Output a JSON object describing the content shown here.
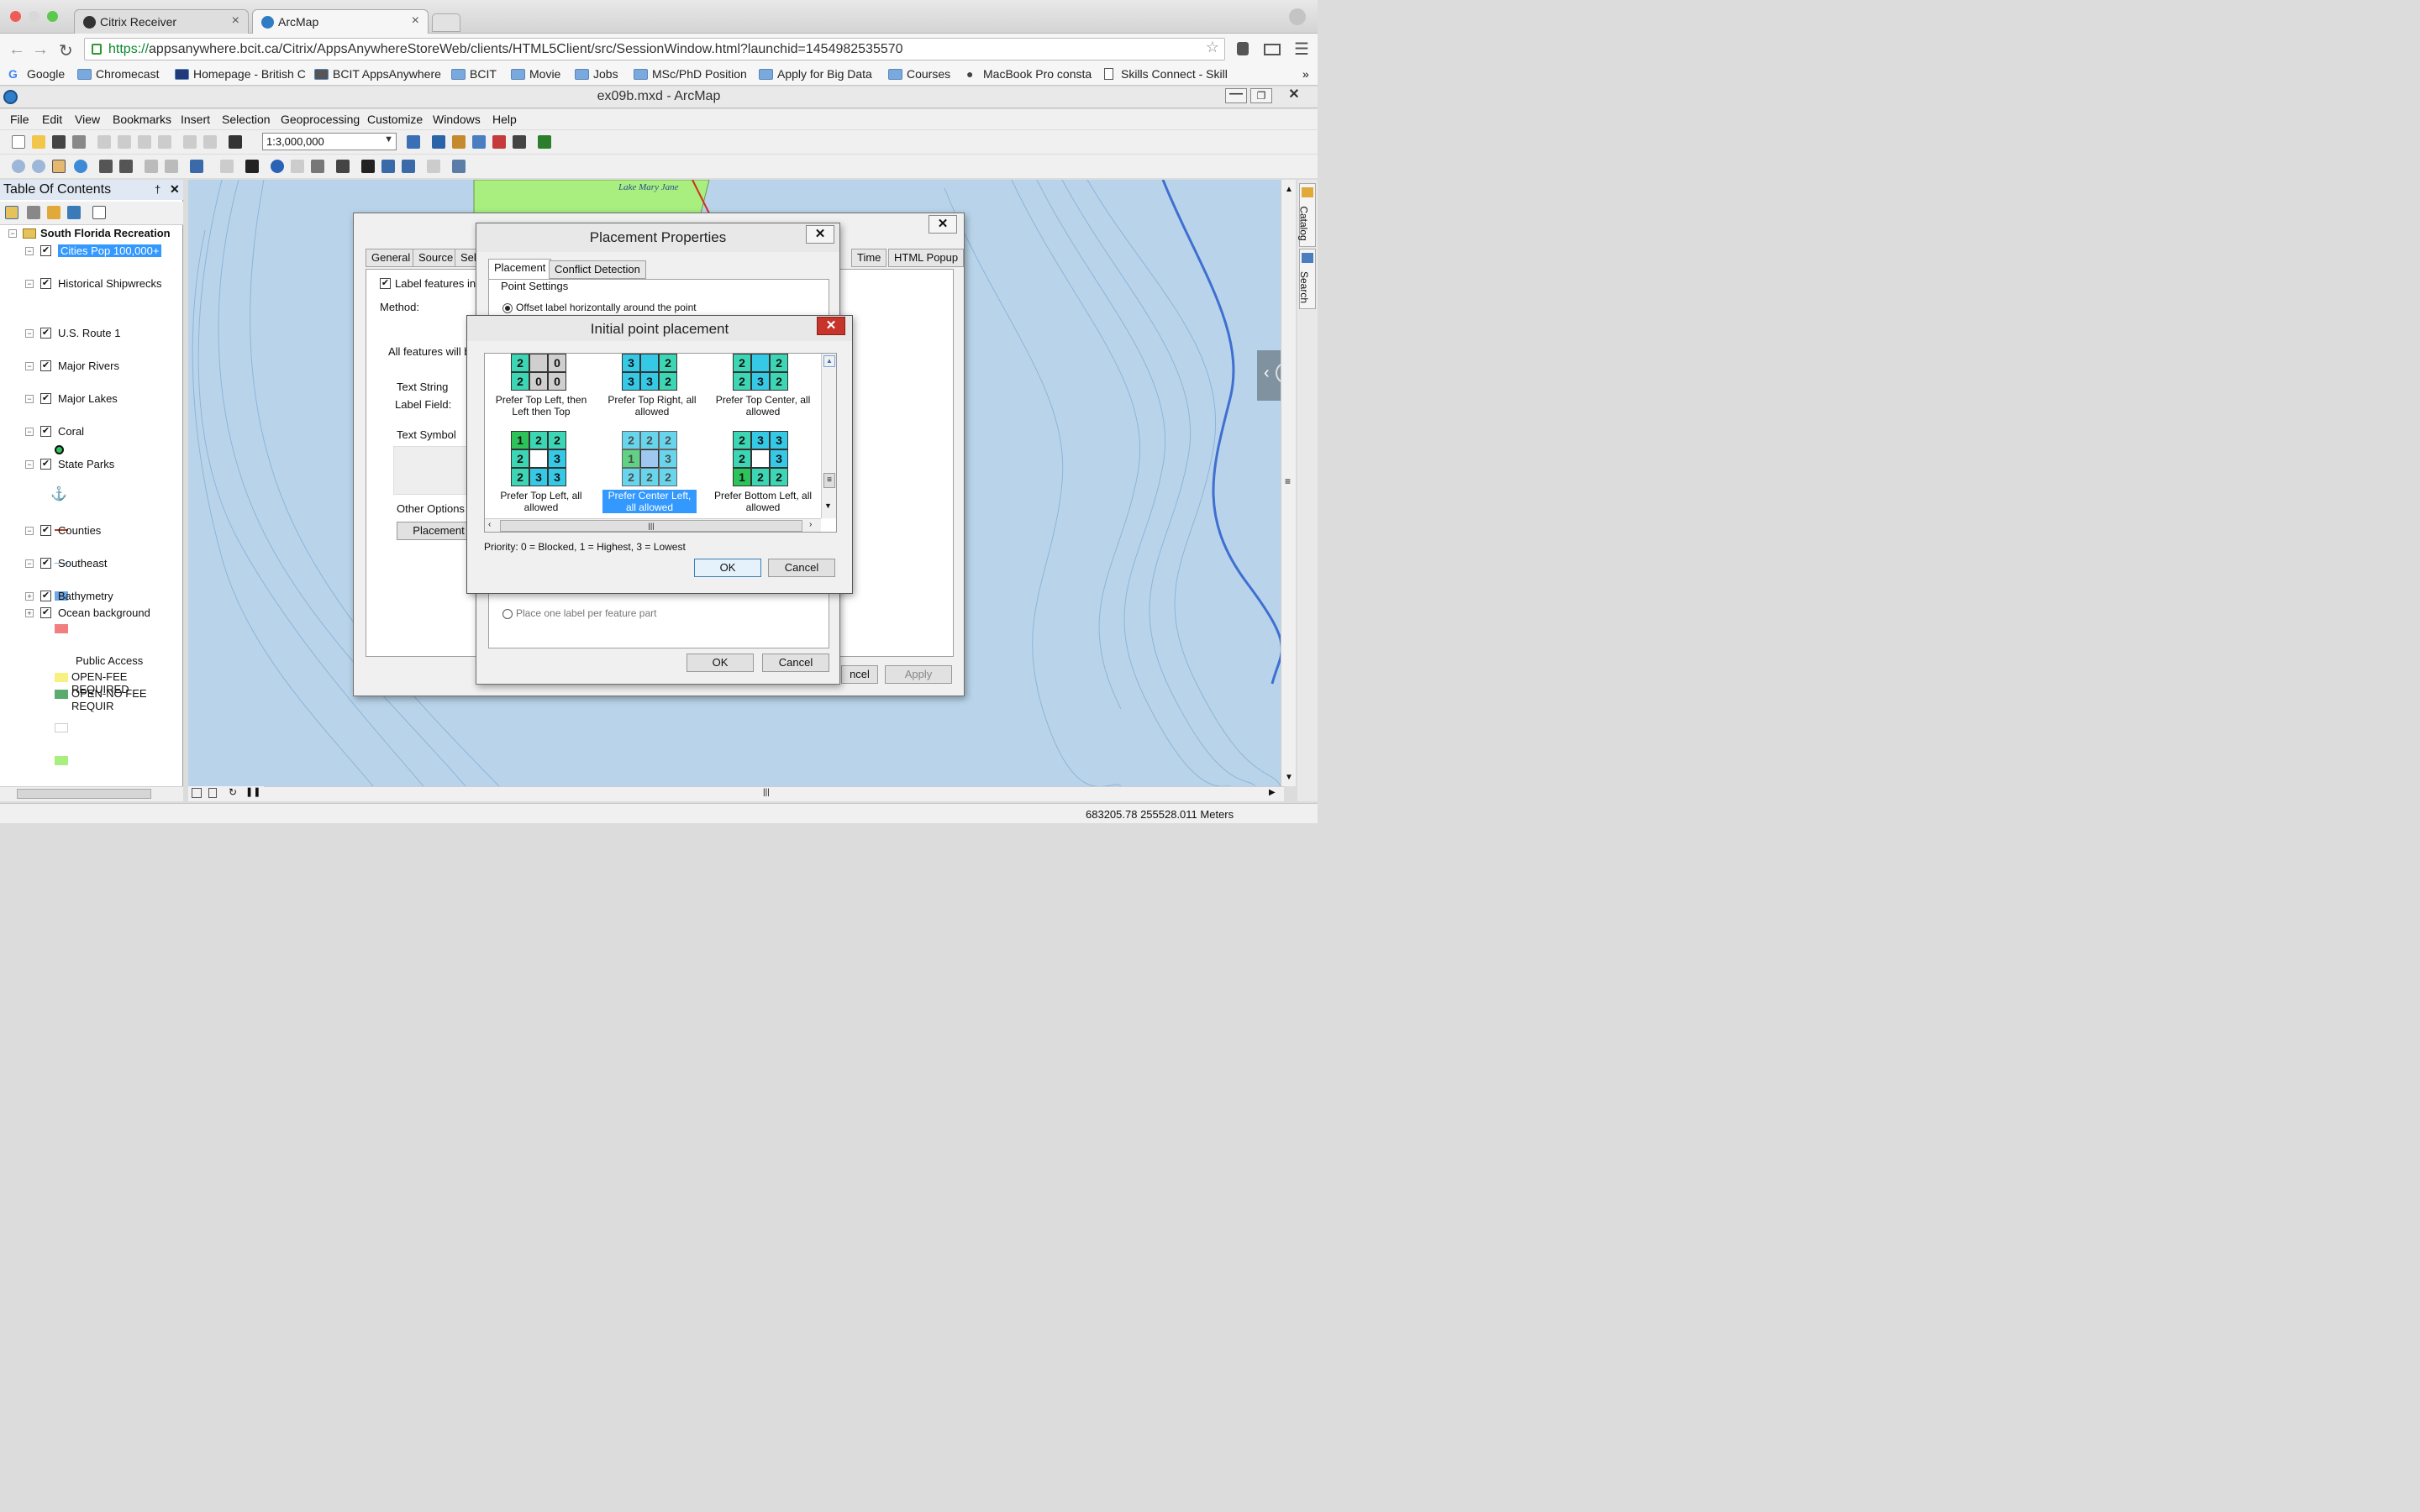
{
  "browser": {
    "tabs": [
      {
        "label": "Citrix Receiver"
      },
      {
        "label": "ArcMap"
      }
    ],
    "url_https": "https://",
    "url_rest": "appsanywhere.bcit.ca/Citrix/AppsAnywhereStoreWeb/clients/HTML5Client/src/SessionWindow.html?launchid=1454982535570",
    "bookmarks": [
      "Google",
      "Chromecast",
      "Homepage - British C",
      "BCIT AppsAnywhere",
      "BCIT",
      "Movie",
      "Jobs",
      "MSc/PhD Position",
      "Apply for Big Data",
      "Courses",
      "MacBook Pro consta",
      "Skills Connect - Skill"
    ],
    "more_bookmarks": "»"
  },
  "arcmap": {
    "title": "ex09b.mxd - ArcMap",
    "menu": [
      "File",
      "Edit",
      "View",
      "Bookmarks",
      "Insert",
      "Selection",
      "Geoprocessing",
      "Customize",
      "Windows",
      "Help"
    ],
    "scale": "1:3,000,000",
    "status_coords": "683205.78  255528.011 Meters"
  },
  "toc": {
    "title": "Table Of Contents",
    "pin": "†",
    "close": "✕",
    "dataframe": "South Florida Recreation",
    "layers": [
      {
        "name": "Cities Pop 100,000+"
      },
      {
        "name": "Historical Shipwrecks"
      },
      {
        "name": "U.S. Route 1"
      },
      {
        "name": "Major Rivers"
      },
      {
        "name": "Major Lakes"
      },
      {
        "name": "Coral"
      },
      {
        "name": "State Parks"
      },
      {
        "name": "Counties"
      },
      {
        "name": "Southeast"
      },
      {
        "name": "Bathymetry"
      },
      {
        "name": "Ocean background"
      }
    ],
    "state_parks_heading": "Public Access",
    "state_parks_classes": [
      "OPEN-FEE REQUIRED",
      "OPEN-NO FEE REQUIR"
    ]
  },
  "map": {
    "lake_label": "Lake Mary Jane",
    "right_dock": [
      "Catalog",
      "Search"
    ]
  },
  "colors": {
    "selection": "#3399ff",
    "map_water": "#b9d4ea",
    "land": "#a8ef80",
    "coral": "#f08080",
    "fee": "#f8f080",
    "nofee": "#5cab6e"
  },
  "layer_props": {
    "tabs": [
      "General",
      "Source",
      "Sele",
      "Time",
      "HTML Popup"
    ],
    "label_features": "Label features in th",
    "method": "Method:",
    "all_features": "All features will be",
    "text_string": "Text String",
    "label_field": "Label Field:",
    "text_symbol": "Text Symbol",
    "other_options": "Other Options",
    "placement_btn": "Placement",
    "cancel": "ncel",
    "apply": "Apply",
    "close": "✕"
  },
  "placement_props": {
    "title": "Placement Properties",
    "tabs": [
      "Placement",
      "Conflict Detection"
    ],
    "point_settings": "Point Settings",
    "offset_option": "Offset label horizontally around the point",
    "per_part": "Place one label per feature part",
    "ok": "OK",
    "cancel": "Cancel",
    "close": "✕"
  },
  "initial_placement": {
    "title": "Initial point placement",
    "close": "✕",
    "options": [
      {
        "label": "Prefer Top Left, then Left then Top",
        "grid": [
          "20",
          "200",
          "00"
        ]
      },
      {
        "label": "Prefer Top Right, all allowed",
        "grid": [
          "3",
          "2",
          "332"
        ]
      },
      {
        "label": "Prefer Top Center, all allowed",
        "grid": [
          "2",
          "2",
          "232"
        ]
      },
      {
        "label": "Prefer Top Left, all allowed",
        "grid": [
          "122",
          "2 3",
          "233"
        ]
      },
      {
        "label": "Prefer Center Left, all allowed",
        "grid": [
          "222",
          "1 3",
          "222"
        ]
      },
      {
        "label": "Prefer Bottom Left, all allowed",
        "grid": [
          "233",
          "2 3",
          "122"
        ]
      }
    ],
    "priority_note": "Priority:  0 = Blocked, 1 = Highest, 3 = Lowest",
    "ok": "OK",
    "cancel": "Cancel"
  }
}
